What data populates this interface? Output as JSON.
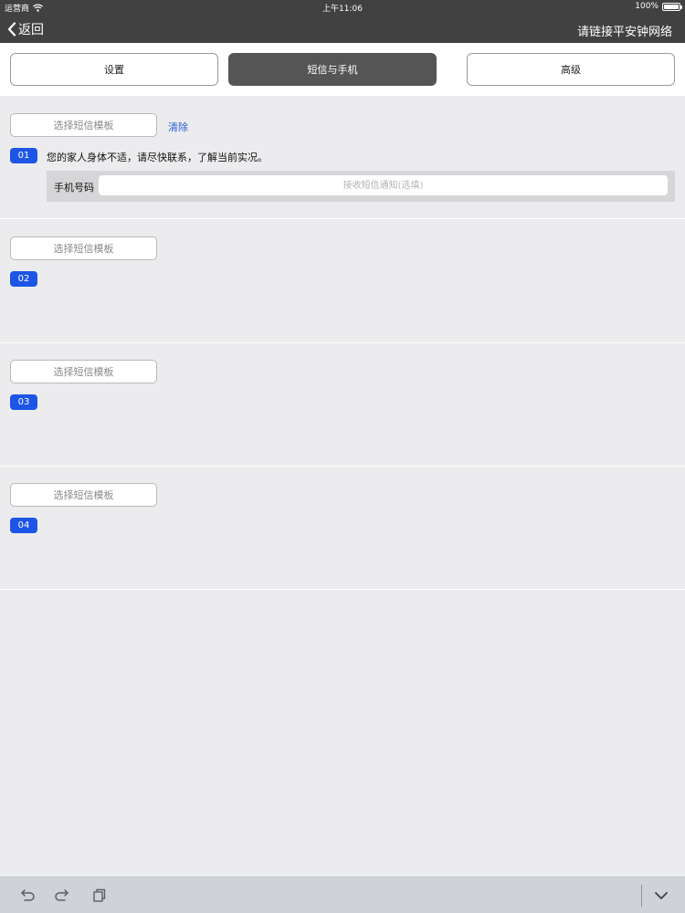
{
  "status_bar": {
    "carrier": "运营商",
    "time": "上午11:06",
    "battery": "100%",
    "wifi_icon": "wifi-icon",
    "battery_icon": "battery-icon"
  },
  "nav": {
    "back_label": "返回",
    "status_text": "请链接平安钟网络"
  },
  "tabs": [
    {
      "label": "设置",
      "active": false
    },
    {
      "label": "短信与手机",
      "active": true
    },
    {
      "label": "高级",
      "active": false
    }
  ],
  "sections": [
    {
      "template_button": "选择短信模板",
      "clear_label": "清除",
      "number": "01",
      "message": "您的家人身体不适，请尽快联系，了解当前实况。",
      "phone_label": "手机号码",
      "phone_placeholder": "接收短信通知(选填)"
    },
    {
      "template_button": "选择短信模板",
      "number": "02"
    },
    {
      "template_button": "选择短信模板",
      "number": "03"
    },
    {
      "template_button": "选择短信模板",
      "number": "04"
    }
  ],
  "colors": {
    "header_bg": "#414141",
    "active_tab": "#555555",
    "badge": "#1d56e6",
    "link": "#2d5fd3"
  }
}
